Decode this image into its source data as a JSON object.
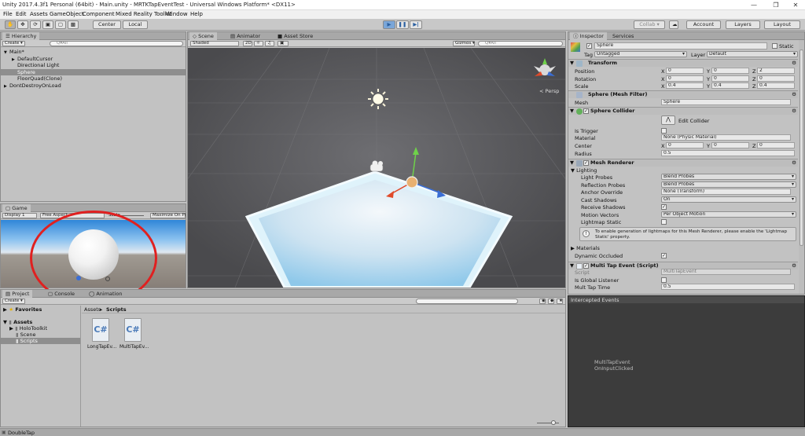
{
  "window": {
    "title": "Unity 2017.4.3f1 Personal (64bit) - Main.unity - MRTKTapEventTest - Universal Windows Platform* <DX11>"
  },
  "menu": [
    "File",
    "Edit",
    "Assets",
    "GameObject",
    "Component",
    "Mixed Reality Toolkit",
    "Window",
    "Help"
  ],
  "toolbar": {
    "center": "Center",
    "local": "Local",
    "collab": "Collab ▾",
    "account": "Account",
    "layers": "Layers",
    "layout": "Layout"
  },
  "hierarchy": {
    "tab": "Hierarchy",
    "create": "Create ▾",
    "search": "Q▾All",
    "items": [
      {
        "label": "Main*",
        "indent": 0,
        "arrow": "▼",
        "selected": false
      },
      {
        "label": "DefaultCursor",
        "indent": 1,
        "arrow": "▶",
        "selected": false
      },
      {
        "label": "Directional Light",
        "indent": 1,
        "arrow": "",
        "selected": false
      },
      {
        "label": "Sphere",
        "indent": 1,
        "arrow": "",
        "selected": true
      },
      {
        "label": "FloorQuad(Clone)",
        "indent": 1,
        "arrow": "",
        "selected": false
      },
      {
        "label": "DontDestroyOnLoad",
        "indent": 0,
        "arrow": "▶",
        "selected": false
      }
    ]
  },
  "game": {
    "tab": "Game",
    "display": "Display 1",
    "aspect": "Free Aspect",
    "scale": "Scale",
    "maximize": "Maximize On Pl"
  },
  "scene": {
    "tabs": [
      "Scene",
      "Animator",
      "Asset Store"
    ],
    "shading": "Shaded",
    "mode2d": "2D",
    "gizmos": "Gizmos ▾",
    "search": "Q▾All",
    "persp": "< Persp"
  },
  "project": {
    "tabs": [
      "Project",
      "Console",
      "Animation"
    ],
    "create": "Create ▾",
    "favorites": "Favorites",
    "assets": "Assets",
    "tree": [
      "HoloToolkit",
      "Scene",
      "Scripts"
    ],
    "breadcrumb": [
      "Assets",
      "Scripts"
    ],
    "files": [
      "LongTapEv...",
      "MultiTapEv..."
    ],
    "file_glyph": "C#"
  },
  "inspector": {
    "tabs": [
      "Inspector",
      "Services"
    ],
    "name": "Sphere",
    "static": "Static",
    "tag_label": "Tag",
    "tag": "Untagged",
    "layer_label": "Layer",
    "layer": "Default",
    "transform": {
      "title": "Transform",
      "rows": [
        {
          "label": "Position",
          "x": "0",
          "y": "0",
          "z": "2"
        },
        {
          "label": "Rotation",
          "x": "0",
          "y": "0",
          "z": "0"
        },
        {
          "label": "Scale",
          "x": "0.4",
          "y": "0.4",
          "z": "0.4"
        }
      ]
    },
    "axis": {
      "x": "X",
      "y": "Y",
      "z": "Z"
    },
    "meshfilter": {
      "title": "Sphere (Mesh Filter)",
      "mesh_label": "Mesh",
      "mesh": "Sphere"
    },
    "collider": {
      "title": "Sphere Collider",
      "edit": "Edit Collider",
      "trigger": "Is Trigger",
      "material_label": "Material",
      "material": "None (Physic Material)",
      "center_label": "Center",
      "cx": "0",
      "cy": "0",
      "cz": "0",
      "radius_label": "Radius",
      "radius": "0.5"
    },
    "renderer": {
      "title": "Mesh Renderer",
      "lighting": "Lighting",
      "light_probes_label": "Light Probes",
      "light_probes": "Blend Probes",
      "reflection_label": "Reflection Probes",
      "reflection": "Blend Probes",
      "anchor_label": "Anchor Override",
      "anchor": "None (Transform)",
      "cast_label": "Cast Shadows",
      "cast": "On",
      "receive_label": "Receive Shadows",
      "motion_label": "Motion Vectors",
      "motion": "Per Object Motion",
      "static_label": "Lightmap Static",
      "info": "To enable generation of lightmaps for this Mesh Renderer, please enable the 'Lightmap Static' property.",
      "materials": "Materials",
      "occluded": "Dynamic Occluded"
    },
    "script": {
      "title": "Multi Tap Event (Script)",
      "script_label": "Script",
      "script": "MultiTapEvent",
      "global_label": "Is Global Listener",
      "time_label": "Mult Tap Time",
      "time": "0.5"
    }
  },
  "events": {
    "title": "Intercepted Events",
    "lines": [
      "MultiTapEvent",
      "OnInputClicked"
    ]
  },
  "statusbar": {
    "text": "DoubleTap"
  }
}
